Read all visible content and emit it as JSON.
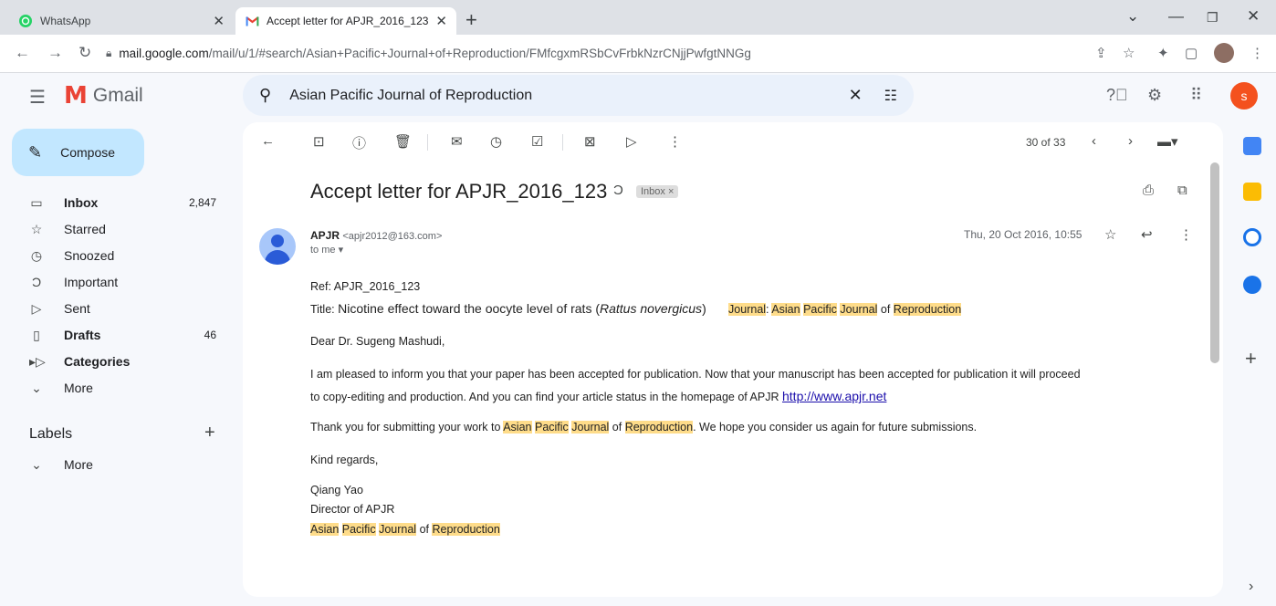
{
  "browser": {
    "tabs": [
      {
        "title": "WhatsApp",
        "favicon": "whatsapp-icon",
        "active": false
      },
      {
        "title": "Accept letter for APJR_2016_123",
        "favicon": "gmail-icon",
        "active": true
      }
    ],
    "url_host": "mail.google.com",
    "url_path": "/mail/u/1/#search/Asian+Pacific+Journal+of+Reproduction/FMfcgxmRSbCvFrbkNzrCNjjPwfgtNNGg"
  },
  "gmail": {
    "product": "Gmail",
    "search_query": "Asian Pacific Journal of Reproduction",
    "avatar_letter": "s",
    "compose_label": "Compose",
    "nav": [
      {
        "label": "Inbox",
        "icon": "inbox-icon",
        "count": "2,847",
        "bold": true
      },
      {
        "label": "Starred",
        "icon": "star-icon",
        "count": "",
        "bold": false
      },
      {
        "label": "Snoozed",
        "icon": "clock-icon",
        "count": "",
        "bold": false
      },
      {
        "label": "Important",
        "icon": "important-icon",
        "count": "",
        "bold": false
      },
      {
        "label": "Sent",
        "icon": "send-icon",
        "count": "",
        "bold": false
      },
      {
        "label": "Drafts",
        "icon": "draft-icon",
        "count": "46",
        "bold": true
      },
      {
        "label": "Categories",
        "icon": "label-icon",
        "count": "",
        "bold": true
      },
      {
        "label": "More",
        "icon": "chevron-down-icon",
        "count": "",
        "bold": false
      }
    ],
    "labels_header": "Labels",
    "labels_more": "More",
    "pager": "30 of 33"
  },
  "email": {
    "subject": "Accept letter for APJR_2016_123",
    "inbox_chip": "Inbox ×",
    "sender_name": "APJR",
    "sender_email": "<apjr2012@163.com>",
    "to": "to me",
    "date": "Thu, 20 Oct 2016, 10:55",
    "ref": "Ref: APJR_2016_123",
    "title_label": "Title: ",
    "title_text": "Nicotine effect toward the oocyte level of rats (",
    "title_species": "Rattus novergicus",
    "title_close": ")",
    "journal_label": "Journal",
    "journal_words": [
      "Asian",
      "Pacific",
      "Journal",
      "of",
      "Reproduction"
    ],
    "greeting": "Dear Dr. Sugeng Mashudi,",
    "para1_line1": "I am pleased to inform you that your paper has been accepted for publication. Now that your manuscript has been accepted for publication it will proceed",
    "para1_line2": "to copy-editing and production. And you can find your article status in the homepage of APJR ",
    "link": "http://www.apjr.net",
    "para2_pre": "Thank you for submitting your work to ",
    "para2_post": ". We hope you consider us again for future submissions.",
    "regards": "Kind regards,",
    "sig_name": "Qiang Yao",
    "sig_title": "Director of APJR"
  },
  "colors": {
    "accent": "#c2e7ff",
    "highlight": "#fedc8a",
    "avatar": "#f4511e"
  }
}
